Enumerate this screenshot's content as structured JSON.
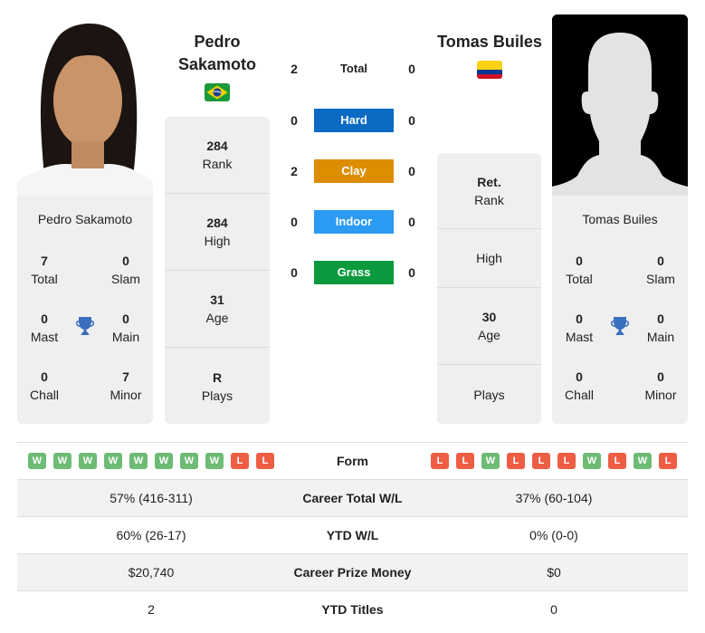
{
  "colors": {
    "hard": "#0b6bc2",
    "clay": "#dd8d00",
    "indoor": "#2b9af3",
    "grass": "#0b9a3e",
    "win": "#6dbb75",
    "loss": "#ee5e45",
    "trophy": "#3a6fbf"
  },
  "player_left": {
    "name": "Pedro Sakamoto",
    "name_line1": "Pedro",
    "name_line2": "Sakamoto",
    "flag": "brazil-flag",
    "titles": {
      "total": {
        "value": "7",
        "label": "Total"
      },
      "slam": {
        "value": "0",
        "label": "Slam"
      },
      "mast": {
        "value": "0",
        "label": "Mast"
      },
      "main": {
        "value": "0",
        "label": "Main"
      },
      "chall": {
        "value": "0",
        "label": "Chall"
      },
      "minor": {
        "value": "7",
        "label": "Minor"
      }
    },
    "stats": [
      {
        "value": "284",
        "label": "Rank"
      },
      {
        "value": "284",
        "label": "High"
      },
      {
        "value": "31",
        "label": "Age"
      },
      {
        "value": "R",
        "label": "Plays"
      }
    ]
  },
  "player_right": {
    "name": "Tomas Builes",
    "flag": "colombia-flag",
    "titles": {
      "total": {
        "value": "0",
        "label": "Total"
      },
      "slam": {
        "value": "0",
        "label": "Slam"
      },
      "mast": {
        "value": "0",
        "label": "Mast"
      },
      "main": {
        "value": "0",
        "label": "Main"
      },
      "chall": {
        "value": "0",
        "label": "Chall"
      },
      "minor": {
        "value": "0",
        "label": "Minor"
      }
    },
    "stats": [
      {
        "value": "Ret.",
        "label": "Rank"
      },
      {
        "value": "",
        "label": "High"
      },
      {
        "value": "30",
        "label": "Age"
      },
      {
        "value": "",
        "label": "Plays"
      }
    ]
  },
  "h2h": [
    {
      "label": "Total",
      "left": "2",
      "right": "0"
    },
    {
      "label": "Hard",
      "left": "0",
      "right": "0"
    },
    {
      "label": "Clay",
      "left": "2",
      "right": "0"
    },
    {
      "label": "Indoor",
      "left": "0",
      "right": "0"
    },
    {
      "label": "Grass",
      "left": "0",
      "right": "0"
    }
  ],
  "table": {
    "form_label": "Form",
    "form_left": [
      "W",
      "W",
      "W",
      "W",
      "W",
      "W",
      "W",
      "W",
      "L",
      "L"
    ],
    "form_right": [
      "L",
      "L",
      "W",
      "L",
      "L",
      "L",
      "W",
      "L",
      "W",
      "L"
    ],
    "rows": [
      {
        "label": "Career Total W/L",
        "left": "57% (416-311)",
        "right": "37% (60-104)"
      },
      {
        "label": "YTD W/L",
        "left": "60% (26-17)",
        "right": "0% (0-0)"
      },
      {
        "label": "Career Prize Money",
        "left": "$20,740",
        "right": "$0"
      },
      {
        "label": "YTD Titles",
        "left": "2",
        "right": "0"
      }
    ]
  }
}
